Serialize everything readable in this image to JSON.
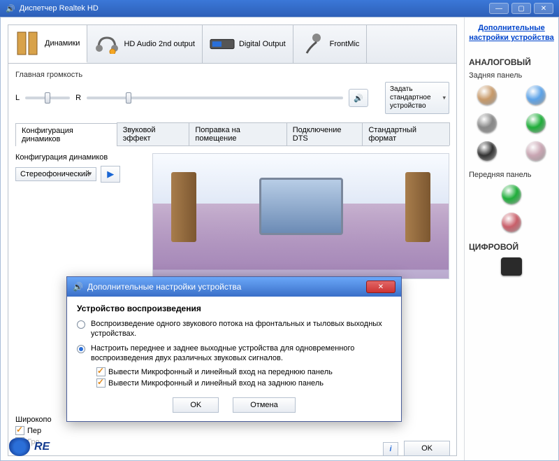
{
  "window": {
    "title": "Диспетчер Realtek HD"
  },
  "devices": [
    {
      "label": "Динамики",
      "active": true
    },
    {
      "label": "HD Audio 2nd output",
      "active": false
    },
    {
      "label": "Digital Output",
      "active": false
    },
    {
      "label": "FrontMic",
      "active": false
    }
  ],
  "extra_link": "Дополнительные настройки устройства",
  "analog": {
    "heading": "АНАЛОГОВЫЙ",
    "rear_label": "Задняя панель",
    "rear_jacks": [
      "#c89a6a",
      "#5da3e8",
      "#888888",
      "#1fae3a",
      "#333333",
      "#c9a6b3"
    ],
    "front_label": "Передняя панель",
    "front_jacks": [
      "#1fae3a",
      "#c95f6a"
    ]
  },
  "digital": {
    "heading": "ЦИФРОВОЙ"
  },
  "volume": {
    "label": "Главная громкость",
    "left": "L",
    "right": "R",
    "default_btn": "Задать стандартное устройство"
  },
  "subtabs": [
    "Конфигурация динамиков",
    "Звуковой эффект",
    "Поправка на помещение",
    "Подключение DTS",
    "Стандартный формат"
  ],
  "active_subtab": 0,
  "config": {
    "label": "Конфигурация динамиков",
    "select_value": "Стереофонический"
  },
  "fullscreen": {
    "label_prefix": "Широкопо",
    "front": "Пер",
    "surround": "Гро"
  },
  "footer": {
    "ok": "OK",
    "brand": "RE"
  },
  "dialog": {
    "title": "Дополнительные настройки устройства",
    "group": "Устройство воспроизведения",
    "opt1": "Воспроизведение одного звукового потока на фронтальных и тыловых выходных устройствах.",
    "opt2": "Настроить переднее и заднее выходные устройства для одновременного воспроизведения двух различных звуковых сигналов.",
    "chk1": "Вывести Микрофонный и линейный вход на переднюю панель",
    "chk2": "Вывести Микрофонный и линейный вход на заднюю панель",
    "ok": "OK",
    "cancel": "Отмена"
  }
}
